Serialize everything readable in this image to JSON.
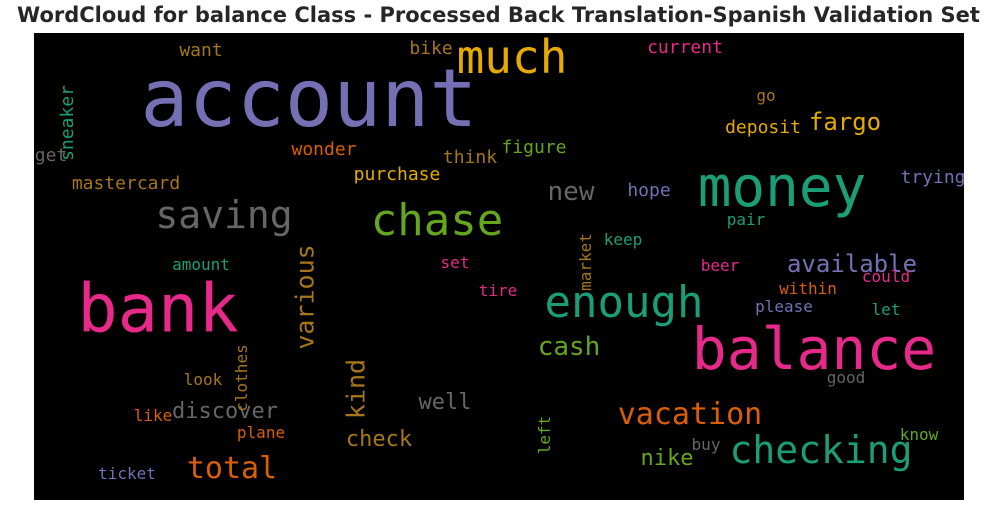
{
  "title": "WordCloud for balance Class - Processed Back Translation-Spanish Validation Set",
  "chart_data": {
    "type": "wordcloud",
    "title": "WordCloud for balance Class - Processed Back Translation-Spanish Validation Set",
    "background": "#000000",
    "words": [
      {
        "text": "account",
        "weight": 1.0,
        "color": "#7570b3",
        "vertical": false
      },
      {
        "text": "balance",
        "weight": 0.72,
        "color": "#e7298a",
        "vertical": false
      },
      {
        "text": "bank",
        "weight": 0.84,
        "color": "#e7298a",
        "vertical": false
      },
      {
        "text": "money",
        "weight": 0.7,
        "color": "#1b9e77",
        "vertical": false
      },
      {
        "text": "much",
        "weight": 0.58,
        "color": "#e6ab02",
        "vertical": false
      },
      {
        "text": "chase",
        "weight": 0.55,
        "color": "#66a61e",
        "vertical": false
      },
      {
        "text": "enough",
        "weight": 0.55,
        "color": "#1b9e77",
        "vertical": false
      },
      {
        "text": "checking",
        "weight": 0.48,
        "color": "#1b9e77",
        "vertical": false
      },
      {
        "text": "saving",
        "weight": 0.47,
        "color": "#666666",
        "vertical": false
      },
      {
        "text": "total",
        "weight": 0.37,
        "color": "#d95f02",
        "vertical": false
      },
      {
        "text": "vacation",
        "weight": 0.37,
        "color": "#d95f02",
        "vertical": false
      },
      {
        "text": "cash",
        "weight": 0.33,
        "color": "#66a61e",
        "vertical": false
      },
      {
        "text": "new",
        "weight": 0.33,
        "color": "#666666",
        "vertical": false
      },
      {
        "text": "various",
        "weight": 0.31,
        "color": "#a6761d",
        "vertical": true
      },
      {
        "text": "kind",
        "weight": 0.31,
        "color": "#a6761d",
        "vertical": true
      },
      {
        "text": "available",
        "weight": 0.3,
        "color": "#7570b3",
        "vertical": false
      },
      {
        "text": "fargo",
        "weight": 0.3,
        "color": "#e6ab02",
        "vertical": false
      },
      {
        "text": "discover",
        "weight": 0.28,
        "color": "#666666",
        "vertical": false
      },
      {
        "text": "well",
        "weight": 0.28,
        "color": "#666666",
        "vertical": false
      },
      {
        "text": "check",
        "weight": 0.27,
        "color": "#a6761d",
        "vertical": false
      },
      {
        "text": "nike",
        "weight": 0.27,
        "color": "#66a61e",
        "vertical": false
      },
      {
        "text": "want",
        "weight": 0.22,
        "color": "#a6761d",
        "vertical": false
      },
      {
        "text": "bike",
        "weight": 0.22,
        "color": "#a6761d",
        "vertical": false
      },
      {
        "text": "current",
        "weight": 0.22,
        "color": "#e7298a",
        "vertical": false
      },
      {
        "text": "sneaker",
        "weight": 0.22,
        "color": "#1b9e77",
        "vertical": true
      },
      {
        "text": "go",
        "weight": 0.2,
        "color": "#a6761d",
        "vertical": false
      },
      {
        "text": "deposit",
        "weight": 0.22,
        "color": "#e6ab02",
        "vertical": false
      },
      {
        "text": "get",
        "weight": 0.22,
        "color": "#666666",
        "vertical": false
      },
      {
        "text": "wonder",
        "weight": 0.22,
        "color": "#d95f02",
        "vertical": false
      },
      {
        "text": "think",
        "weight": 0.22,
        "color": "#a6761d",
        "vertical": false
      },
      {
        "text": "figure",
        "weight": 0.22,
        "color": "#66a61e",
        "vertical": false
      },
      {
        "text": "mastercard",
        "weight": 0.22,
        "color": "#a6761d",
        "vertical": false
      },
      {
        "text": "purchase",
        "weight": 0.22,
        "color": "#e6ab02",
        "vertical": false
      },
      {
        "text": "hope",
        "weight": 0.22,
        "color": "#7570b3",
        "vertical": false
      },
      {
        "text": "trying",
        "weight": 0.22,
        "color": "#7570b3",
        "vertical": false
      },
      {
        "text": "pair",
        "weight": 0.2,
        "color": "#1b9e77",
        "vertical": false
      },
      {
        "text": "keep",
        "weight": 0.2,
        "color": "#1b9e77",
        "vertical": false
      },
      {
        "text": "market",
        "weight": 0.2,
        "color": "#a6761d",
        "vertical": true
      },
      {
        "text": "amount",
        "weight": 0.2,
        "color": "#1b9e77",
        "vertical": false
      },
      {
        "text": "set",
        "weight": 0.2,
        "color": "#e7298a",
        "vertical": false
      },
      {
        "text": "beer",
        "weight": 0.2,
        "color": "#e7298a",
        "vertical": false
      },
      {
        "text": "could",
        "weight": 0.2,
        "color": "#e7298a",
        "vertical": false
      },
      {
        "text": "within",
        "weight": 0.2,
        "color": "#d95f02",
        "vertical": false
      },
      {
        "text": "tire",
        "weight": 0.2,
        "color": "#e7298a",
        "vertical": false
      },
      {
        "text": "please",
        "weight": 0.2,
        "color": "#7570b3",
        "vertical": false
      },
      {
        "text": "let",
        "weight": 0.2,
        "color": "#1b9e77",
        "vertical": false
      },
      {
        "text": "clothes",
        "weight": 0.2,
        "color": "#a6761d",
        "vertical": true
      },
      {
        "text": "look",
        "weight": 0.2,
        "color": "#a6761d",
        "vertical": false
      },
      {
        "text": "good",
        "weight": 0.2,
        "color": "#666666",
        "vertical": false
      },
      {
        "text": "like",
        "weight": 0.2,
        "color": "#d95f02",
        "vertical": false
      },
      {
        "text": "plane",
        "weight": 0.2,
        "color": "#d95f02",
        "vertical": false
      },
      {
        "text": "left",
        "weight": 0.2,
        "color": "#66a61e",
        "vertical": true
      },
      {
        "text": "know",
        "weight": 0.2,
        "color": "#66a61e",
        "vertical": false
      },
      {
        "text": "buy",
        "weight": 0.2,
        "color": "#666666",
        "vertical": false
      },
      {
        "text": "ticket",
        "weight": 0.2,
        "color": "#7570b3",
        "vertical": false
      }
    ]
  }
}
